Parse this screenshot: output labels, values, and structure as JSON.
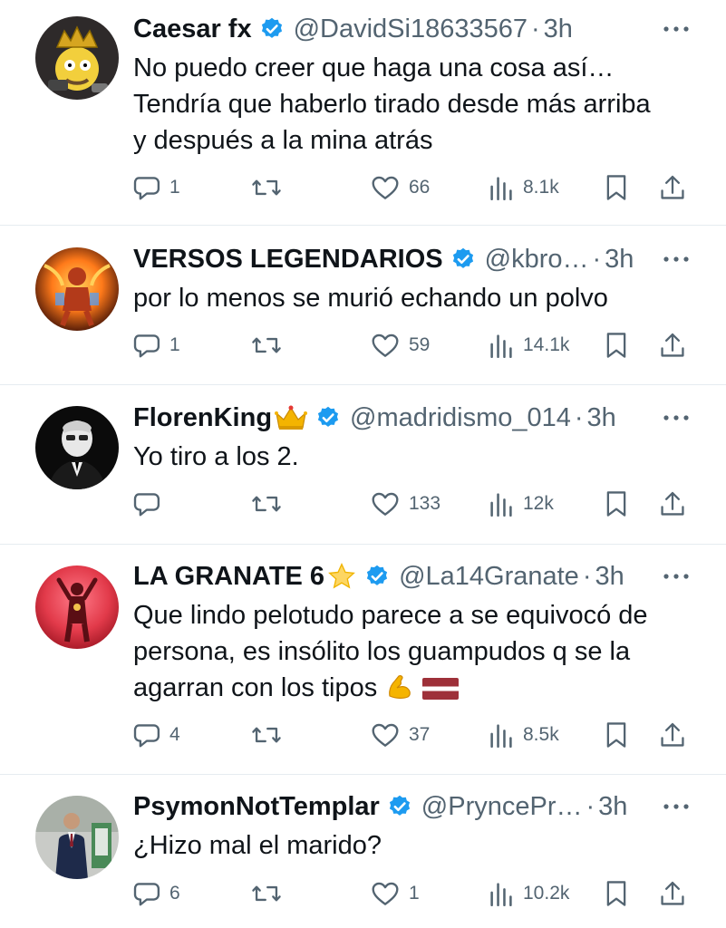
{
  "tweets": [
    {
      "name": "Caesar fx",
      "name_emoji": "",
      "handle": "@DavidSi18633567",
      "dot": "·",
      "time": "3h",
      "text": "No puedo creer que haga una cosa así…\nTendría que haberlo tirado desde más arriba\ny después a la mina atrás",
      "replies": "1",
      "retweets": "",
      "likes": "66",
      "views": "8.1k"
    },
    {
      "name": "VERSOS LEGENDARIOS",
      "name_emoji": "",
      "handle": "@kbro…",
      "dot": "·",
      "time": "3h",
      "text": "por lo menos se murió echando un polvo",
      "replies": "1",
      "retweets": "",
      "likes": "59",
      "views": "14.1k"
    },
    {
      "name": "FlorenKing",
      "name_emoji": "crown",
      "handle": "@madridismo_014",
      "dot": "·",
      "time": "3h",
      "text": "Yo tiro a los 2.",
      "replies": "",
      "retweets": "",
      "likes": "133",
      "views": "12k"
    },
    {
      "name": "LA GRANATE 6",
      "name_emoji": "star",
      "handle": "@La14Granate",
      "dot": "·",
      "time": "3h",
      "text": "Que lindo pelotudo parece a se equivocó de\npersona, es insólito los guampudos q se la\nagarran con los tipos",
      "text_emojis": [
        "flexed-biceps",
        "latvia-flag"
      ],
      "replies": "4",
      "retweets": "",
      "likes": "37",
      "views": "8.5k"
    },
    {
      "name": "PsymonNotTemplar",
      "name_emoji": "",
      "handle": "@PryncePr…",
      "dot": "·",
      "time": "3h",
      "text": "¿Hizo mal el marido?",
      "replies": "6",
      "retweets": "",
      "likes": "1",
      "views": "10.2k"
    }
  ],
  "colors": {
    "text": "#0f1419",
    "secondary": "#536471",
    "verified": "#1d9bf0",
    "divider": "#e6ecf0"
  },
  "icons": {
    "reply": "reply-icon",
    "retweet": "retweet-icon",
    "like": "heart-icon",
    "views": "views-icon",
    "bookmark": "bookmark-icon",
    "share": "share-icon",
    "more": "more-icon",
    "verified": "verified-badge-icon"
  }
}
